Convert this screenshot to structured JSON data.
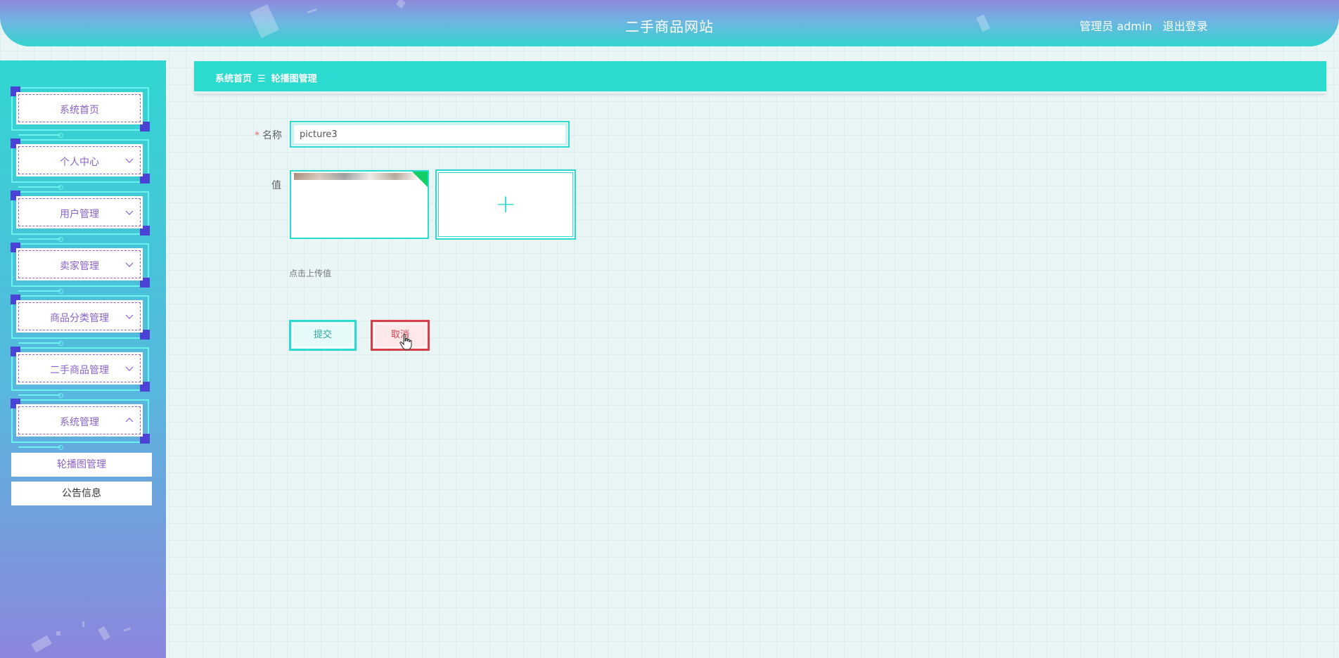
{
  "header": {
    "site_title": "二手商品网站",
    "role_label": "管理员 admin",
    "logout_label": "退出登录"
  },
  "sidebar": {
    "items": [
      {
        "label": "系统首页",
        "has_chevron": false
      },
      {
        "label": "个人中心",
        "has_chevron": true
      },
      {
        "label": "用户管理",
        "has_chevron": true
      },
      {
        "label": "卖家管理",
        "has_chevron": true
      },
      {
        "label": "商品分类管理",
        "has_chevron": true
      },
      {
        "label": "二手商品管理",
        "has_chevron": true
      },
      {
        "label": "系统管理",
        "has_chevron": true,
        "expanded": true
      }
    ],
    "submenu": [
      {
        "label": "轮播图管理",
        "active": true
      },
      {
        "label": "公告信息",
        "active": false
      }
    ]
  },
  "breadcrumb": {
    "home": "系统首页",
    "separator": "☰",
    "current": "轮播图管理"
  },
  "form": {
    "name_label": "名称",
    "name_required": "*",
    "name_value": "picture3",
    "value_label": "值",
    "upload_tip": "点击上传值",
    "upload_add_symbol": "+",
    "submit_label": "提交",
    "cancel_label": "取消"
  },
  "colors": {
    "accent": "#2bdbcf",
    "menu_text": "#8a63c7",
    "danger": "#d43f4a",
    "success_badge": "#13ce66"
  }
}
